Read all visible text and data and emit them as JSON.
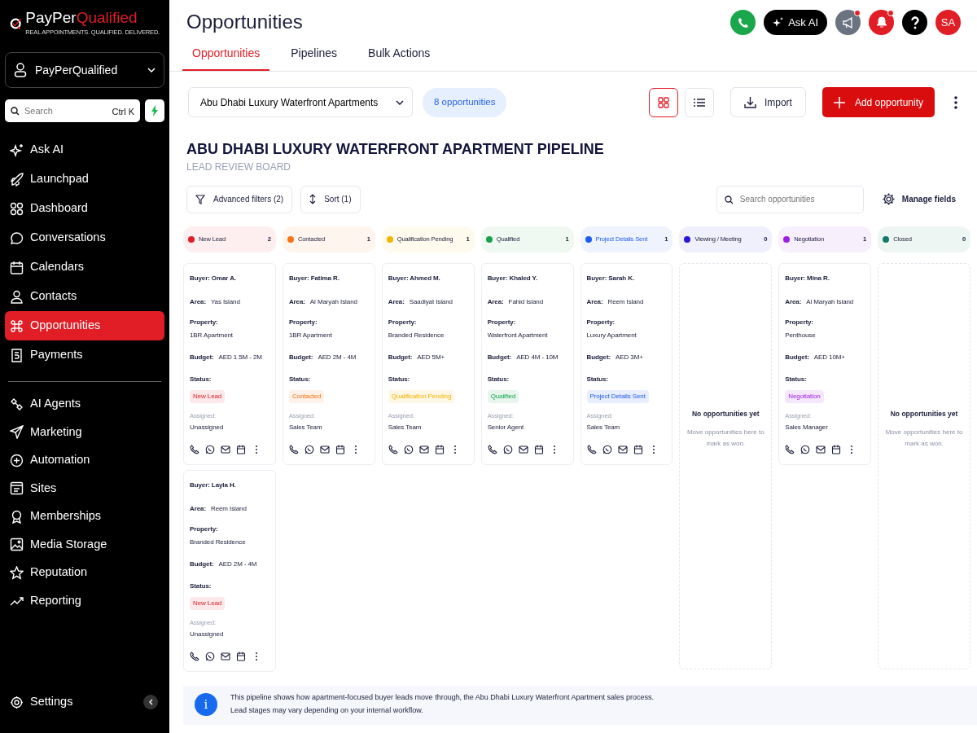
{
  "brand": {
    "name_a": "PayPer",
    "name_b": "Qualified",
    "tagline": "REAL APPOINTMENTS. QUALIFIED. DELIVERED."
  },
  "account": {
    "name": "PayPerQualified"
  },
  "sidebar_search": {
    "placeholder": "Search",
    "shortcut": "Ctrl K"
  },
  "sidebar": {
    "items": [
      {
        "label": "Ask AI",
        "selected": false
      },
      {
        "label": "Launchpad",
        "selected": false
      },
      {
        "label": "Dashboard",
        "selected": false
      },
      {
        "label": "Conversations",
        "selected": false
      },
      {
        "label": "Calendars",
        "selected": false
      },
      {
        "label": "Contacts",
        "selected": false
      },
      {
        "label": "Opportunities",
        "selected": true
      },
      {
        "label": "Payments",
        "selected": false
      }
    ],
    "items_2": [
      {
        "label": "AI Agents",
        "selected": false
      },
      {
        "label": "Marketing",
        "selected": false
      },
      {
        "label": "Automation",
        "selected": false
      },
      {
        "label": "Sites",
        "selected": false
      },
      {
        "label": "Memberships",
        "selected": false
      },
      {
        "label": "Media Storage",
        "selected": false
      },
      {
        "label": "Reputation",
        "selected": false
      },
      {
        "label": "Reporting",
        "selected": false
      }
    ],
    "settings": "Settings"
  },
  "page_title": "Opportunities",
  "header": {
    "ask_ai": "Ask AI",
    "avatar": "SA"
  },
  "tabs": [
    {
      "label": "Opportunities",
      "selected": true
    },
    {
      "label": "Pipelines",
      "selected": false
    },
    {
      "label": "Bulk Actions",
      "selected": false
    }
  ],
  "pipeline_select": "Abu Dhabi Luxury Waterfront Apartments",
  "count_badge": "8 opportunities",
  "view_toggle": [
    {
      "kind": "grid",
      "selected": true
    },
    {
      "kind": "list",
      "selected": false
    }
  ],
  "import_button": "Import",
  "add_button": "Add opportunity",
  "board_title": "ABU DHABI LUXURY WATERFRONT APARTMENT PIPELINE",
  "board_subtitle": "LEAD REVIEW BOARD",
  "filters": "Advanced filters (2)",
  "sort": "Sort (1)",
  "search": {
    "placeholder": "Search opportunities"
  },
  "manage_fields": "Manage fields",
  "columns": [
    {
      "name": "New Lead",
      "count": "2",
      "color": "#e11d26",
      "selected": false,
      "cards": [
        {
          "buyer": "Buyer: Omar A.",
          "area_label": "Area:",
          "area": "Yas Island",
          "property_label": "Property:",
          "property": "1BR Apartment",
          "budget_label": "Budget:",
          "budget": "AED 1.5M - 2M",
          "status_label": "Status:",
          "status": "New Lead",
          "assigned_label": "Assigned:",
          "assignee": "Unassigned"
        },
        {
          "buyer": "Buyer: Layla H.",
          "area_label": "Area:",
          "area": "Reem Island",
          "property_label": "Property:",
          "property": "Branded Residence",
          "budget_label": "Budget:",
          "budget": "AED 2M - 4M",
          "status_label": "Status:",
          "status": "New Lead",
          "assigned_label": "Assigned:",
          "assignee": "Unassigned"
        }
      ]
    },
    {
      "name": "Contacted",
      "count": "1",
      "color": "#f97316",
      "selected": false,
      "cards": [
        {
          "buyer": "Buyer: Fatima R.",
          "area_label": "Area:",
          "area": "Al Maryah Island",
          "property_label": "Property:",
          "property": "1BR Apartment",
          "budget_label": "Budget:",
          "budget": "AED 2M - 4M",
          "status_label": "Status:",
          "status": "Contacted",
          "assigned_label": "Assigned:",
          "assignee": "Sales Team"
        }
      ]
    },
    {
      "name": "Qualification Pending",
      "count": "1",
      "color": "#f5b400",
      "selected": false,
      "cards": [
        {
          "buyer": "Buyer: Ahmed M.",
          "area_label": "Area:",
          "area": "Saadiyat Island",
          "property_label": "Property:",
          "property": "Branded Residence",
          "budget_label": "Budget:",
          "budget": "AED 5M+",
          "status_label": "Status:",
          "status": "Qualification Pending",
          "assigned_label": "Assigned:",
          "assignee": "Sales Team"
        }
      ]
    },
    {
      "name": "Qualified",
      "count": "1",
      "color": "#16a34a",
      "selected": false,
      "cards": [
        {
          "buyer": "Buyer: Khaled Y.",
          "area_label": "Area:",
          "area": "Fahid Island",
          "property_label": "Property:",
          "property": "Waterfront Apartment",
          "budget_label": "Budget:",
          "budget": "AED 4M - 10M",
          "status_label": "Status:",
          "status": "Qualified",
          "assigned_label": "Assigned:",
          "assignee": "Senior Agent"
        }
      ]
    },
    {
      "name": "Project Details Sent",
      "count": "1",
      "color": "#1d5cf0",
      "selected": true,
      "cards": [
        {
          "buyer": "Buyer: Sarah K.",
          "area_label": "Area:",
          "area": "Reem Island",
          "property_label": "Property:",
          "property": "Luxury Apartment",
          "budget_label": "Budget:",
          "budget": "AED 3M+",
          "status_label": "Status:",
          "status": "Project Details Sent",
          "assigned_label": "Assigned:",
          "assignee": "Sales Team"
        }
      ]
    },
    {
      "name": "Viewing / Meeting",
      "count": "0",
      "color": "#2a16d8",
      "selected": false,
      "empty_title": "No opportunities yet",
      "empty_text": "Move opportunities here to mark as won."
    },
    {
      "name": "Negotiation",
      "count": "1",
      "color": "#9b1ee6",
      "selected": false,
      "cards": [
        {
          "buyer": "Buyer: Mina R.",
          "area_label": "Area:",
          "area": "Al Maryah Island",
          "property_label": "Property:",
          "property": "Penthouse",
          "budget_label": "Budget:",
          "budget": "AED 10M+",
          "status_label": "Status:",
          "status": "Negotiation",
          "assigned_label": "Assigned:",
          "assignee": "Sales Manager"
        }
      ]
    },
    {
      "name": "Closed",
      "count": "0",
      "color": "#0f7a68",
      "selected": false,
      "empty_title": "No opportunities yet",
      "empty_text": "Move opportunities here to mark as won."
    }
  ],
  "info_banner": "This pipeline shows how apartment-focused buyer leads move through‚ the Abu Dhabi Luxury Waterfront Apartment sales process.\nLead stages may vary depending on your internal workflow.",
  "info_icon": "i"
}
